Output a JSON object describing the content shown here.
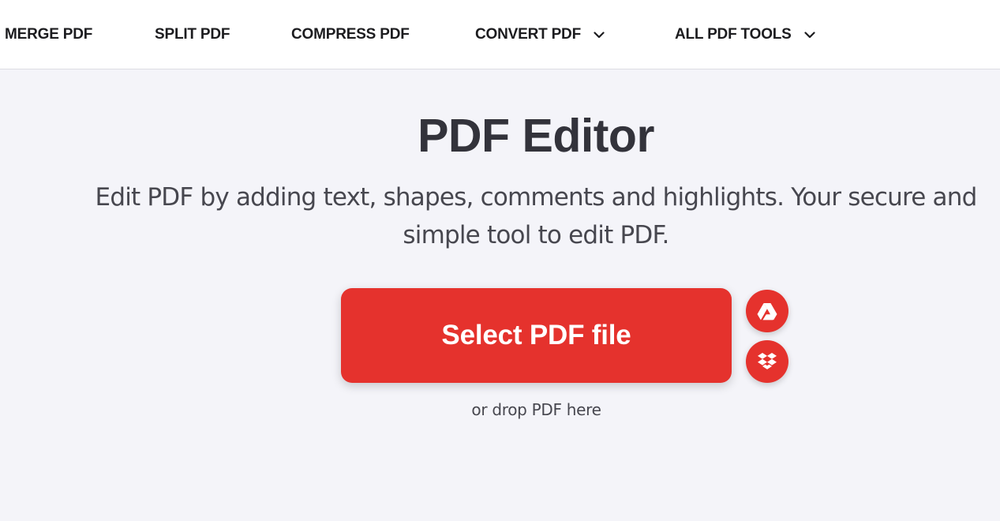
{
  "nav": {
    "items": [
      {
        "label": "MERGE PDF",
        "has_dropdown": false
      },
      {
        "label": "SPLIT PDF",
        "has_dropdown": false
      },
      {
        "label": "COMPRESS PDF",
        "has_dropdown": false
      },
      {
        "label": "CONVERT PDF",
        "has_dropdown": true,
        "icon": "chevron-down-icon"
      },
      {
        "label": "ALL PDF TOOLS",
        "has_dropdown": true,
        "icon": "chevron-down-icon"
      }
    ]
  },
  "hero": {
    "title": "PDF Editor",
    "subtitle": "Edit PDF by adding text, shapes, comments and highlights. Your secure and simple tool to edit PDF."
  },
  "upload": {
    "button_label": "Select PDF file",
    "drop_hint": "or drop PDF here",
    "cloud_sources": [
      {
        "name": "google-drive",
        "icon": "google-drive-icon"
      },
      {
        "name": "dropbox",
        "icon": "dropbox-icon"
      }
    ]
  },
  "colors": {
    "accent": "#e5322d",
    "background": "#f4f4f9",
    "nav_background": "#ffffff",
    "text_dark": "#33333b"
  }
}
